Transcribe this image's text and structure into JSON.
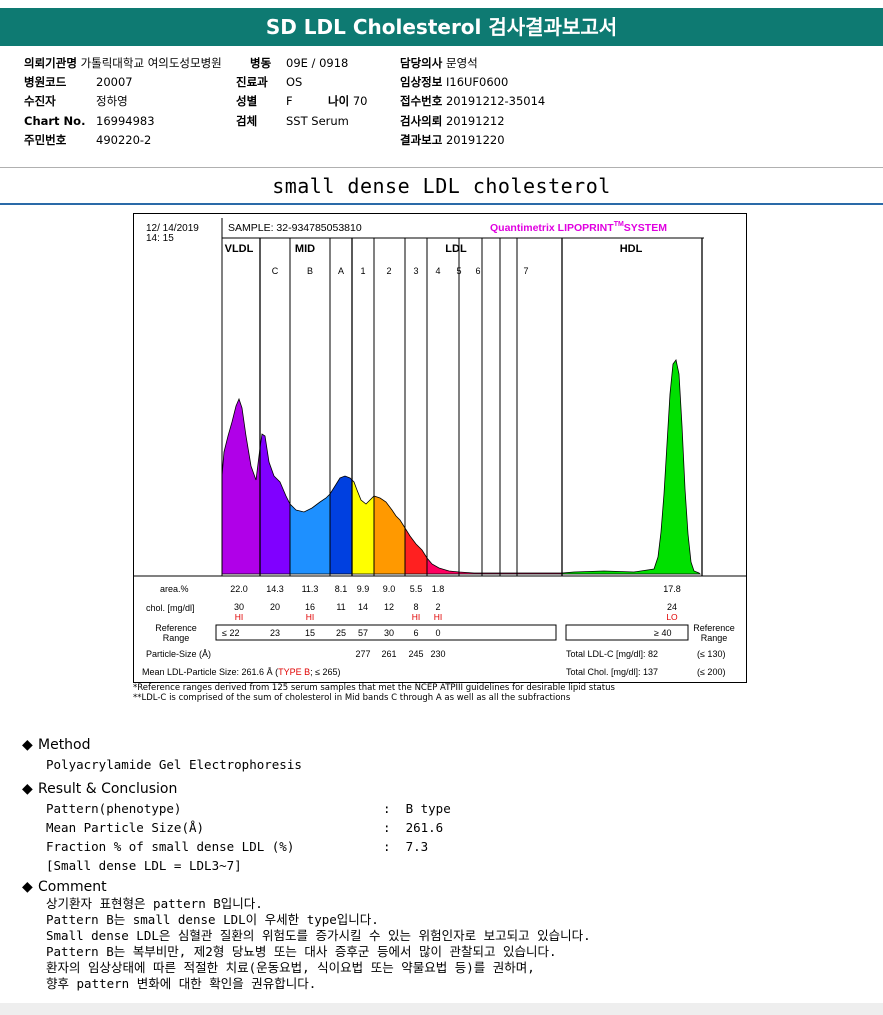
{
  "header": {
    "title": "SD LDL Cholesterol 검사결과보고서"
  },
  "patient": {
    "institution_label": "의뢰기관명",
    "institution": "가톨릭대학교 여의도성모병원",
    "ward_label": "병동",
    "ward": "09E / 0918",
    "doctor_label": "담당의사",
    "doctor": "문영석",
    "hospital_code_label": "병원코드",
    "hospital_code": "20007",
    "dept_label": "진료과",
    "dept": "OS",
    "clinical_label": "임상정보",
    "clinical": "I16UF0600",
    "examinee_label": "수진자",
    "examinee": "정하영",
    "sex_label": "성별",
    "sex": "F",
    "age_label": "나이",
    "age": "70",
    "receipt_label": "접수번호",
    "receipt": "20191212-35014",
    "chart_label": "Chart No.",
    "chart_no": "16994983",
    "specimen_label": "검체",
    "specimen": "SST Serum",
    "request_label": "검사의뢰",
    "request": "20191212",
    "rrn_label": "주민번호",
    "rrn": "490220-2",
    "report_label": "결과보고",
    "report": "20191220"
  },
  "section_title": "small dense LDL cholesterol",
  "lipoprint": {
    "date": "12/ 14/2019",
    "time": "14: 15",
    "sample": "SAMPLE:  32-934785053810",
    "brand": "Quantimetrix LIPOPRINT",
    "brand_tm": "TM",
    "brand_sys": "SYSTEM",
    "groups": [
      "VLDL",
      "MID",
      "LDL",
      "HDL"
    ],
    "bands": [
      "C",
      "B",
      "A",
      "1",
      "2",
      "3",
      "4",
      "5",
      "6",
      "7"
    ],
    "area_label": "area.%",
    "chol_label": "chol. [mg/dl]",
    "ref_label_1": "Reference",
    "ref_label_2": "Range",
    "ref_label_r1": "Reference",
    "ref_label_r2": "Range",
    "particle_label": "Particle-Size (Å)",
    "mean_label": "Mean LDL-Particle Size:  261.6 Å (",
    "mean_type": "TYPE B",
    "mean_suffix": "; ≤ 265)",
    "total_ldl": "Total LDL-C [mg/dl]: 82",
    "total_ldl_ref": "(≤ 130)",
    "total_chol": "Total Chol. [mg/dl]:  137",
    "total_chol_ref": "(≤ 200)",
    "vldl_ref": "≤ 22",
    "hdl_ref": "≥ 40",
    "area_values": [
      "22.0",
      "14.3",
      "11.3",
      "8.1",
      "9.9",
      "9.0",
      "5.5",
      "1.8",
      "17.8"
    ],
    "chol_values": [
      "30",
      "20",
      "16",
      "11",
      "14",
      "12",
      "8",
      "2",
      "24"
    ],
    "flags": [
      "HI",
      "HI",
      "HI",
      "HI",
      "LO"
    ],
    "ref_values": [
      "23",
      "15",
      "25",
      "57",
      "30",
      "6",
      "0"
    ],
    "particle_sizes": [
      "277",
      "261",
      "245",
      "230"
    ],
    "colors": {
      "vldl": "#b000e8",
      "c": "#8000ff",
      "b": "#1e90ff",
      "a": "#0040e0",
      "l1": "#ffff00",
      "l2": "#ff9900",
      "l3": "#ff2020",
      "l4": "#ff0060",
      "hdl": "#00e000",
      "flag": "#e00000",
      "brand": "#e000e0"
    }
  },
  "notes": [
    "*Reference ranges derived from 125 serum samples that met the NCEP ATPIII guidelines for desirable lipid status",
    "**LDL-C is comprised of the sum of cholesterol in Mid bands C through A as well as all the subfractions"
  ],
  "method": {
    "title": "Method",
    "text": "Polyacrylamide Gel Electrophoresis"
  },
  "result": {
    "title": "Result & Conclusion",
    "rows": [
      {
        "label": "Pattern(phenotype)",
        "value": ":  B type"
      },
      {
        "label": "Mean Particle Size(Å)",
        "value": ":  261.6"
      },
      {
        "label": "Fraction % of small dense LDL (%)",
        "value": ":  7.3"
      },
      {
        "label": "[Small dense LDL = LDL3~7]",
        "value": ""
      }
    ]
  },
  "comment": {
    "title": "Comment",
    "lines": [
      "상기환자 표현형은 pattern B입니다.",
      "Pattern B는 small dense LDL이 우세한 type입니다.",
      "Small dense LDL은 심혈관 질환의 위험도를 증가시킬 수 있는 위험인자로 보고되고 있습니다.",
      "Pattern B는 복부비만, 제2형 당뇨병 또는 대사 증후군 등에서 많이 관찰되고 있습니다.",
      "환자의 임상상태에 따른 적절한 치료(운동요법, 식이요법 또는 약물요법 등)를 권하며,",
      "향후 pattern 변화에 대한 확인을 권유합니다."
    ]
  }
}
